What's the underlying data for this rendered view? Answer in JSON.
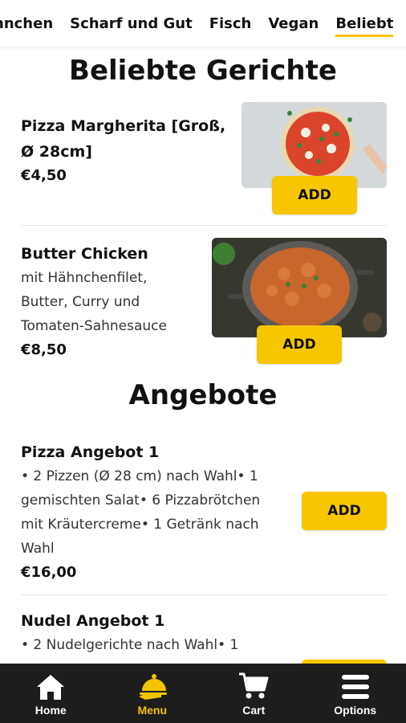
{
  "categories": [
    {
      "label": "hnchen",
      "active": false
    },
    {
      "label": "Scharf und Gut",
      "active": false
    },
    {
      "label": "Fisch",
      "active": false
    },
    {
      "label": "Vegan",
      "active": false
    },
    {
      "label": "Beliebt",
      "active": true
    }
  ],
  "sections": {
    "popular_title": "Beliebte Gerichte",
    "offers_title": "Angebote"
  },
  "popular": [
    {
      "name_line1": "Pizza Margherita [Groß,",
      "name_line2": "Ø 28cm]",
      "price": "€4,50",
      "image": "pizza-margherita-photo"
    },
    {
      "name": "Butter Chicken",
      "desc_lines": [
        "mit Hähnchenfilet,",
        "Butter, Curry und",
        "Tomaten-Sahnesauce"
      ],
      "price": "€8,50",
      "image": "butter-chicken-photo"
    }
  ],
  "offers": [
    {
      "name": "Pizza Angebot 1",
      "desc_lines": [
        "• 2 Pizzen (Ø 28 cm) nach Wahl• 1",
        "gemischten Salat• 6 Pizzabrötchen",
        "mit Kräutercreme• 1 Getränk nach",
        "Wahl"
      ],
      "price": "€16,00"
    },
    {
      "name": "Nudel Angebot 1",
      "desc_lines": [
        "• 2 Nudelgerichte nach Wahl• 1"
      ]
    }
  ],
  "add_label": "ADD",
  "bottom_nav": [
    {
      "label": "Home",
      "icon": "home-icon",
      "active": false
    },
    {
      "label": "Menu",
      "icon": "cloche-icon",
      "active": true
    },
    {
      "label": "Cart",
      "icon": "cart-icon",
      "active": false
    },
    {
      "label": "Options",
      "icon": "hamburger-icon",
      "active": false
    }
  ],
  "colors": {
    "accent": "#f7c600",
    "nav_bg": "#1d1d1d",
    "nav_active": "#f5c400"
  }
}
